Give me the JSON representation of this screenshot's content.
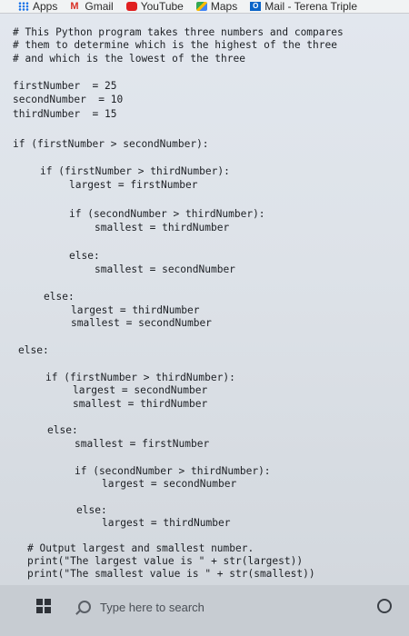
{
  "bookmarks": [
    {
      "label": "Apps",
      "icon": "apps-grid-icon"
    },
    {
      "label": "Gmail",
      "icon": "gmail-icon"
    },
    {
      "label": "YouTube",
      "icon": "youtube-icon"
    },
    {
      "label": "Maps",
      "icon": "maps-icon"
    },
    {
      "label": "Mail - Terena Triple",
      "icon": "outlook-icon"
    }
  ],
  "code_lines": [
    "# This Python program takes three numbers and compares",
    "# them to determine which is the highest of the three",
    "# and which is the lowest of the three",
    "firstNumber  = 25",
    "secondNumber  = 10",
    "thirdNumber  = 15",
    "if (firstNumber > secondNumber):",
    "if (firstNumber > thirdNumber):",
    "largest = firstNumber",
    "if (secondNumber > thirdNumber):",
    "smallest = thirdNumber",
    "else:",
    "smallest = secondNumber",
    "else:",
    "largest = thirdNumber",
    "smallest = secondNumber",
    "else:",
    "if (firstNumber > thirdNumber):",
    "largest = secondNumber",
    "smallest = thirdNumber",
    "else:",
    "smallest = firstNumber",
    "if (secondNumber > thirdNumber):",
    "largest = secondNumber",
    "else:",
    "largest = thirdNumber",
    "# Output largest and smallest number.",
    "print(\"The largest value is \" + str(largest))",
    "print(\"The smallest value is \" + str(smallest))"
  ],
  "taskbar": {
    "search_placeholder": "Type here to search"
  }
}
